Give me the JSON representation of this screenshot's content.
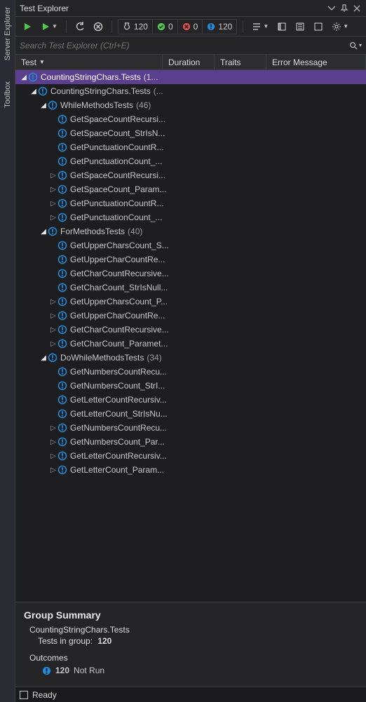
{
  "left_rail": {
    "tabs": [
      "Server Explorer",
      "Toolbox"
    ]
  },
  "titlebar": {
    "title": "Test Explorer"
  },
  "toolbar": {
    "counters": {
      "total": "120",
      "pass": "0",
      "fail": "0",
      "notrun": "120"
    }
  },
  "search": {
    "placeholder": "Search Test Explorer (Ctrl+E)"
  },
  "columns": {
    "test": "Test",
    "duration": "Duration",
    "traits": "Traits",
    "error": "Error Message"
  },
  "tree": [
    {
      "depth": 0,
      "exp": "open",
      "label": "CountingStringChars.Tests",
      "count": "(1...",
      "sel": true
    },
    {
      "depth": 1,
      "exp": "open",
      "label": "CountingStringChars.Tests",
      "count": "(..."
    },
    {
      "depth": 2,
      "exp": "open",
      "label": "WhileMethodsTests",
      "count": "(46)"
    },
    {
      "depth": 3,
      "exp": "none",
      "label": "GetSpaceCountRecursi..."
    },
    {
      "depth": 3,
      "exp": "none",
      "label": "GetSpaceCount_StrIsN..."
    },
    {
      "depth": 3,
      "exp": "none",
      "label": "GetPunctuationCountR..."
    },
    {
      "depth": 3,
      "exp": "none",
      "label": "GetPunctuationCount_..."
    },
    {
      "depth": 3,
      "exp": "closed",
      "label": "GetSpaceCountRecursi..."
    },
    {
      "depth": 3,
      "exp": "closed",
      "label": "GetSpaceCount_Param..."
    },
    {
      "depth": 3,
      "exp": "closed",
      "label": "GetPunctuationCountR..."
    },
    {
      "depth": 3,
      "exp": "closed",
      "label": "GetPunctuationCount_..."
    },
    {
      "depth": 2,
      "exp": "open",
      "label": "ForMethodsTests",
      "count": "(40)"
    },
    {
      "depth": 3,
      "exp": "none",
      "label": "GetUpperCharsCount_S..."
    },
    {
      "depth": 3,
      "exp": "none",
      "label": "GetUpperCharCountRe..."
    },
    {
      "depth": 3,
      "exp": "none",
      "label": "GetCharCountRecursive..."
    },
    {
      "depth": 3,
      "exp": "none",
      "label": "GetCharCount_StrIsNull..."
    },
    {
      "depth": 3,
      "exp": "closed",
      "label": "GetUpperCharsCount_P..."
    },
    {
      "depth": 3,
      "exp": "closed",
      "label": "GetUpperCharCountRe..."
    },
    {
      "depth": 3,
      "exp": "closed",
      "label": "GetCharCountRecursive..."
    },
    {
      "depth": 3,
      "exp": "closed",
      "label": "GetCharCount_Paramet..."
    },
    {
      "depth": 2,
      "exp": "open",
      "label": "DoWhileMethodsTests",
      "count": "(34)"
    },
    {
      "depth": 3,
      "exp": "none",
      "label": "GetNumbersCountRecu..."
    },
    {
      "depth": 3,
      "exp": "none",
      "label": "GetNumbersCount_StrI..."
    },
    {
      "depth": 3,
      "exp": "none",
      "label": "GetLetterCountRecursiv..."
    },
    {
      "depth": 3,
      "exp": "none",
      "label": "GetLetterCount_StrIsNu..."
    },
    {
      "depth": 3,
      "exp": "closed",
      "label": "GetNumbersCountRecu..."
    },
    {
      "depth": 3,
      "exp": "closed",
      "label": "GetNumbersCount_Par..."
    },
    {
      "depth": 3,
      "exp": "closed",
      "label": "GetLetterCountRecursiv..."
    },
    {
      "depth": 3,
      "exp": "closed",
      "label": "GetLetterCount_Param..."
    }
  ],
  "summary": {
    "heading": "Group Summary",
    "group": "CountingStringChars.Tests",
    "tests_label": "Tests in group:",
    "tests_count": "120",
    "outcomes_label": "Outcomes",
    "outcome_count": "120",
    "outcome_text": "Not Run"
  },
  "status": {
    "text": "Ready"
  },
  "colors": {
    "notrun": "#1f8ad8",
    "pass": "#4ec94e",
    "fail": "#e04c4c",
    "flask": "#d8d8d8"
  }
}
